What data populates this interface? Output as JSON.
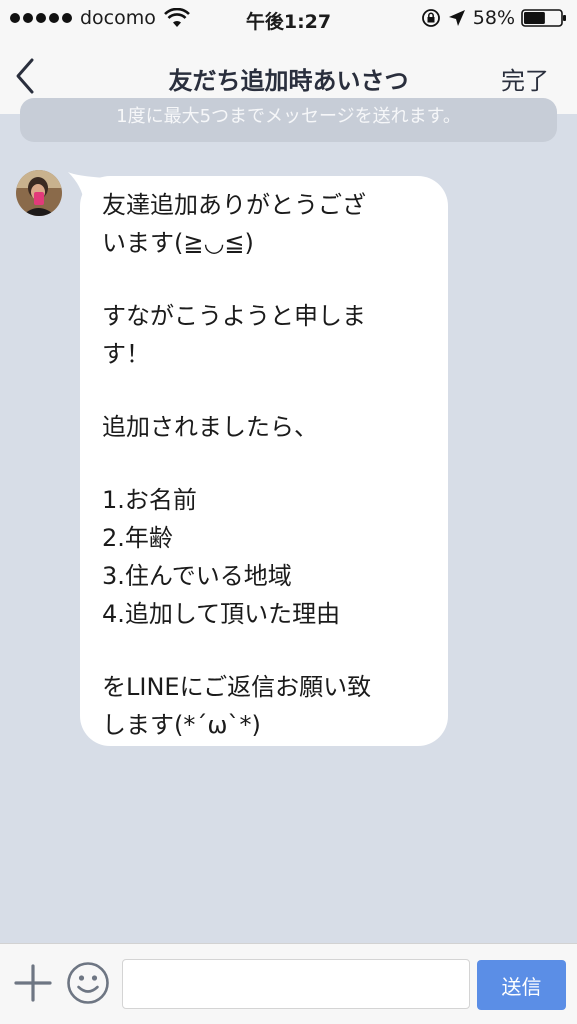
{
  "status_bar": {
    "carrier": "docomo",
    "time": "午後1:27",
    "battery": "58%",
    "signal_bars": 5,
    "battery_level": 0.58
  },
  "nav": {
    "title": "友だち追加時あいさつ",
    "done_label": "完了",
    "back_icon": "chevron-left-icon"
  },
  "notice": {
    "text": "1度に最大5つまでメッセージを送れます。"
  },
  "message": {
    "lines": [
      "友達追加ありがとうござ",
      "います(≧◡≦)",
      "",
      "すながこうようと申しま",
      "す！",
      "",
      "追加されましたら、",
      "",
      "1.お名前",
      "2.年齢",
      "3.住んでいる地域",
      "4.追加して頂いた理由",
      "",
      "をLINEにご返信お願い致",
      "します(*´ω`*)"
    ]
  },
  "input_bar": {
    "input_value": "",
    "send_label": "送信",
    "plus_icon": "plus-icon",
    "emoji_icon": "smiley-icon"
  },
  "colors": {
    "chat_background": "#d7dde7",
    "bar_background": "#f7f7f7",
    "bubble": "#ffffff",
    "send_button": "#5b8ee6",
    "title_text": "#2a2f3d"
  }
}
